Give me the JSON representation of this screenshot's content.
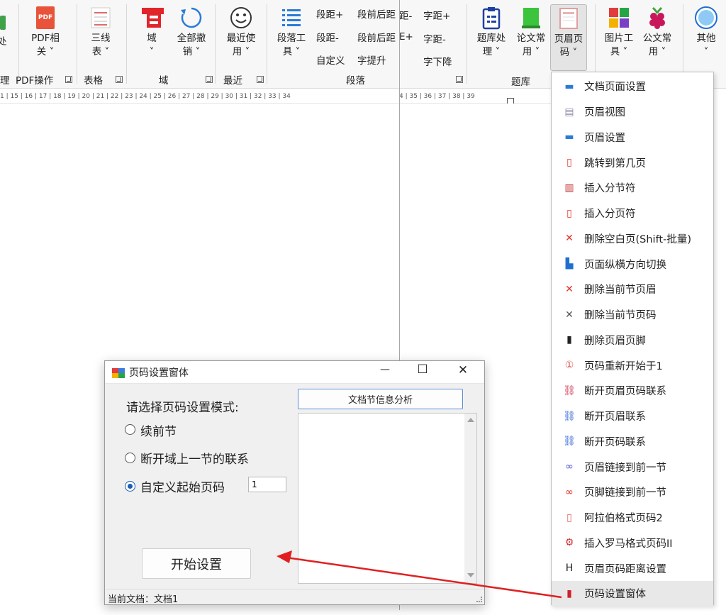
{
  "ribbon_left": {
    "items": [
      {
        "label1": "处",
        "label2": ""
      },
      {
        "label1": "PDF相",
        "label2": "关 ˅"
      },
      {
        "label1": "三线",
        "label2": "表 ˅"
      },
      {
        "label1": "域",
        "label2": "˅"
      },
      {
        "label1": "全部撤",
        "label2": "销 ˅"
      },
      {
        "label1": "最近使",
        "label2": "用 ˅"
      },
      {
        "label1": "段落工",
        "label2": "具 ˅"
      }
    ],
    "pdf_icon_text": "PDF",
    "para_small": [
      "段距+",
      "段距-",
      "自定义",
      "段前后距",
      "段前后距",
      "字提升"
    ],
    "groups": [
      "理",
      "PDF操作",
      "表格",
      "域",
      "最近",
      "段落"
    ]
  },
  "ribbon_right": {
    "char_small": [
      "距-",
      "字距+",
      "E+",
      "字距-",
      "字下降"
    ],
    "items": [
      {
        "label1": "题库处",
        "label2": "理 ˅"
      },
      {
        "label1": "论文常",
        "label2": "用 ˅"
      },
      {
        "label1": "页眉页",
        "label2": "码 ˅"
      },
      {
        "label1": "图片工",
        "label2": "具 ˅"
      },
      {
        "label1": "公文常",
        "label2": "用 ˅"
      },
      {
        "label1": "其他",
        "label2": "˅"
      }
    ],
    "groups": [
      "题库"
    ]
  },
  "ruler_left": "1 | 15 | 16 | 17 | 18 | 19 | 20 | 21 | 22 | 23 | 24 | 25 | 26 | 27 | 28 | 29 | 30 | 31 | 32 | 33 | 34",
  "ruler_right": "4 | 35 | 36 | 37 | 38 | 39",
  "menu": {
    "items": [
      {
        "label": "文档页面设置",
        "icon": "page-setup-icon",
        "glyph": "▬",
        "color": "#2b7bd6"
      },
      {
        "label": "页眉视图",
        "icon": "header-view-icon",
        "glyph": "▤",
        "color": "#8a8aa8"
      },
      {
        "label": "页眉设置",
        "icon": "header-setup-icon",
        "glyph": "▬",
        "color": "#2b7bd6"
      },
      {
        "label": "跳转到第几页",
        "icon": "goto-page-icon",
        "glyph": "▯",
        "color": "#e0342b"
      },
      {
        "label": "插入分节符",
        "icon": "section-break-icon",
        "glyph": "▥",
        "color": "#c03030"
      },
      {
        "label": "插入分页符",
        "icon": "page-break-icon",
        "glyph": "▯",
        "color": "#e0342b"
      },
      {
        "label": "删除空白页(Shift-批量)",
        "icon": "delete-blank-icon",
        "glyph": "✕",
        "color": "#e0342b"
      },
      {
        "label": "页面纵横方向切换",
        "icon": "orientation-icon",
        "glyph": "▙",
        "color": "#1f6fd0"
      },
      {
        "label": "删除当前节页眉",
        "icon": "delete-header-icon",
        "glyph": "✕",
        "color": "#e0342b"
      },
      {
        "label": "删除当前节页码",
        "icon": "delete-pagenum-icon",
        "glyph": "✕",
        "color": "#555555"
      },
      {
        "label": "删除页眉页脚",
        "icon": "trash-icon",
        "glyph": "▮",
        "color": "#222222"
      },
      {
        "label": "页码重新开始于1",
        "icon": "restart-icon",
        "glyph": "①",
        "color": "#e06060"
      },
      {
        "label": "断开页眉页码联系",
        "icon": "unlink-both-icon",
        "glyph": "⛓",
        "color": "#d0304a"
      },
      {
        "label": "断开页眉联系",
        "icon": "unlink-header-icon",
        "glyph": "⛓",
        "color": "#2b5fd6"
      },
      {
        "label": "断开页码联系",
        "icon": "unlink-pagenum-icon",
        "glyph": "⛓",
        "color": "#2b5fd6"
      },
      {
        "label": "页眉链接到前一节",
        "icon": "link-header-icon",
        "glyph": "∞",
        "color": "#5560d0"
      },
      {
        "label": "页脚链接到前一节",
        "icon": "link-footer-icon",
        "glyph": "∞",
        "color": "#e0342b"
      },
      {
        "label": "阿拉伯格式页码2",
        "icon": "arabic-pagenum-icon",
        "glyph": "▯",
        "color": "#e06060"
      },
      {
        "label": "插入罗马格式页码II",
        "icon": "roman-pagenum-icon",
        "glyph": "⚙",
        "color": "#d03030"
      },
      {
        "label": "页眉页码距离设置",
        "icon": "distance-icon",
        "glyph": "H",
        "color": "#222222"
      },
      {
        "label": "页码设置窗体",
        "icon": "pagenum-form-icon",
        "glyph": "▮",
        "color": "#d0202a"
      }
    ]
  },
  "dialog": {
    "title": "页码设置窗体",
    "min_glyph": "—",
    "max_glyph": "☐",
    "close_glyph": "✕",
    "prompt": "请选择页码设置模式:",
    "options": [
      "续前节",
      "断开域上一节的联系",
      "自定义起始页码"
    ],
    "selected_index": 2,
    "start_page_value": "1",
    "analyze_button": "文档节信息分析",
    "start_button": "开始设置",
    "status": "当前文档：文档1"
  },
  "colors": {
    "accent": "#1a5fb4",
    "arrow": "#e02020"
  }
}
